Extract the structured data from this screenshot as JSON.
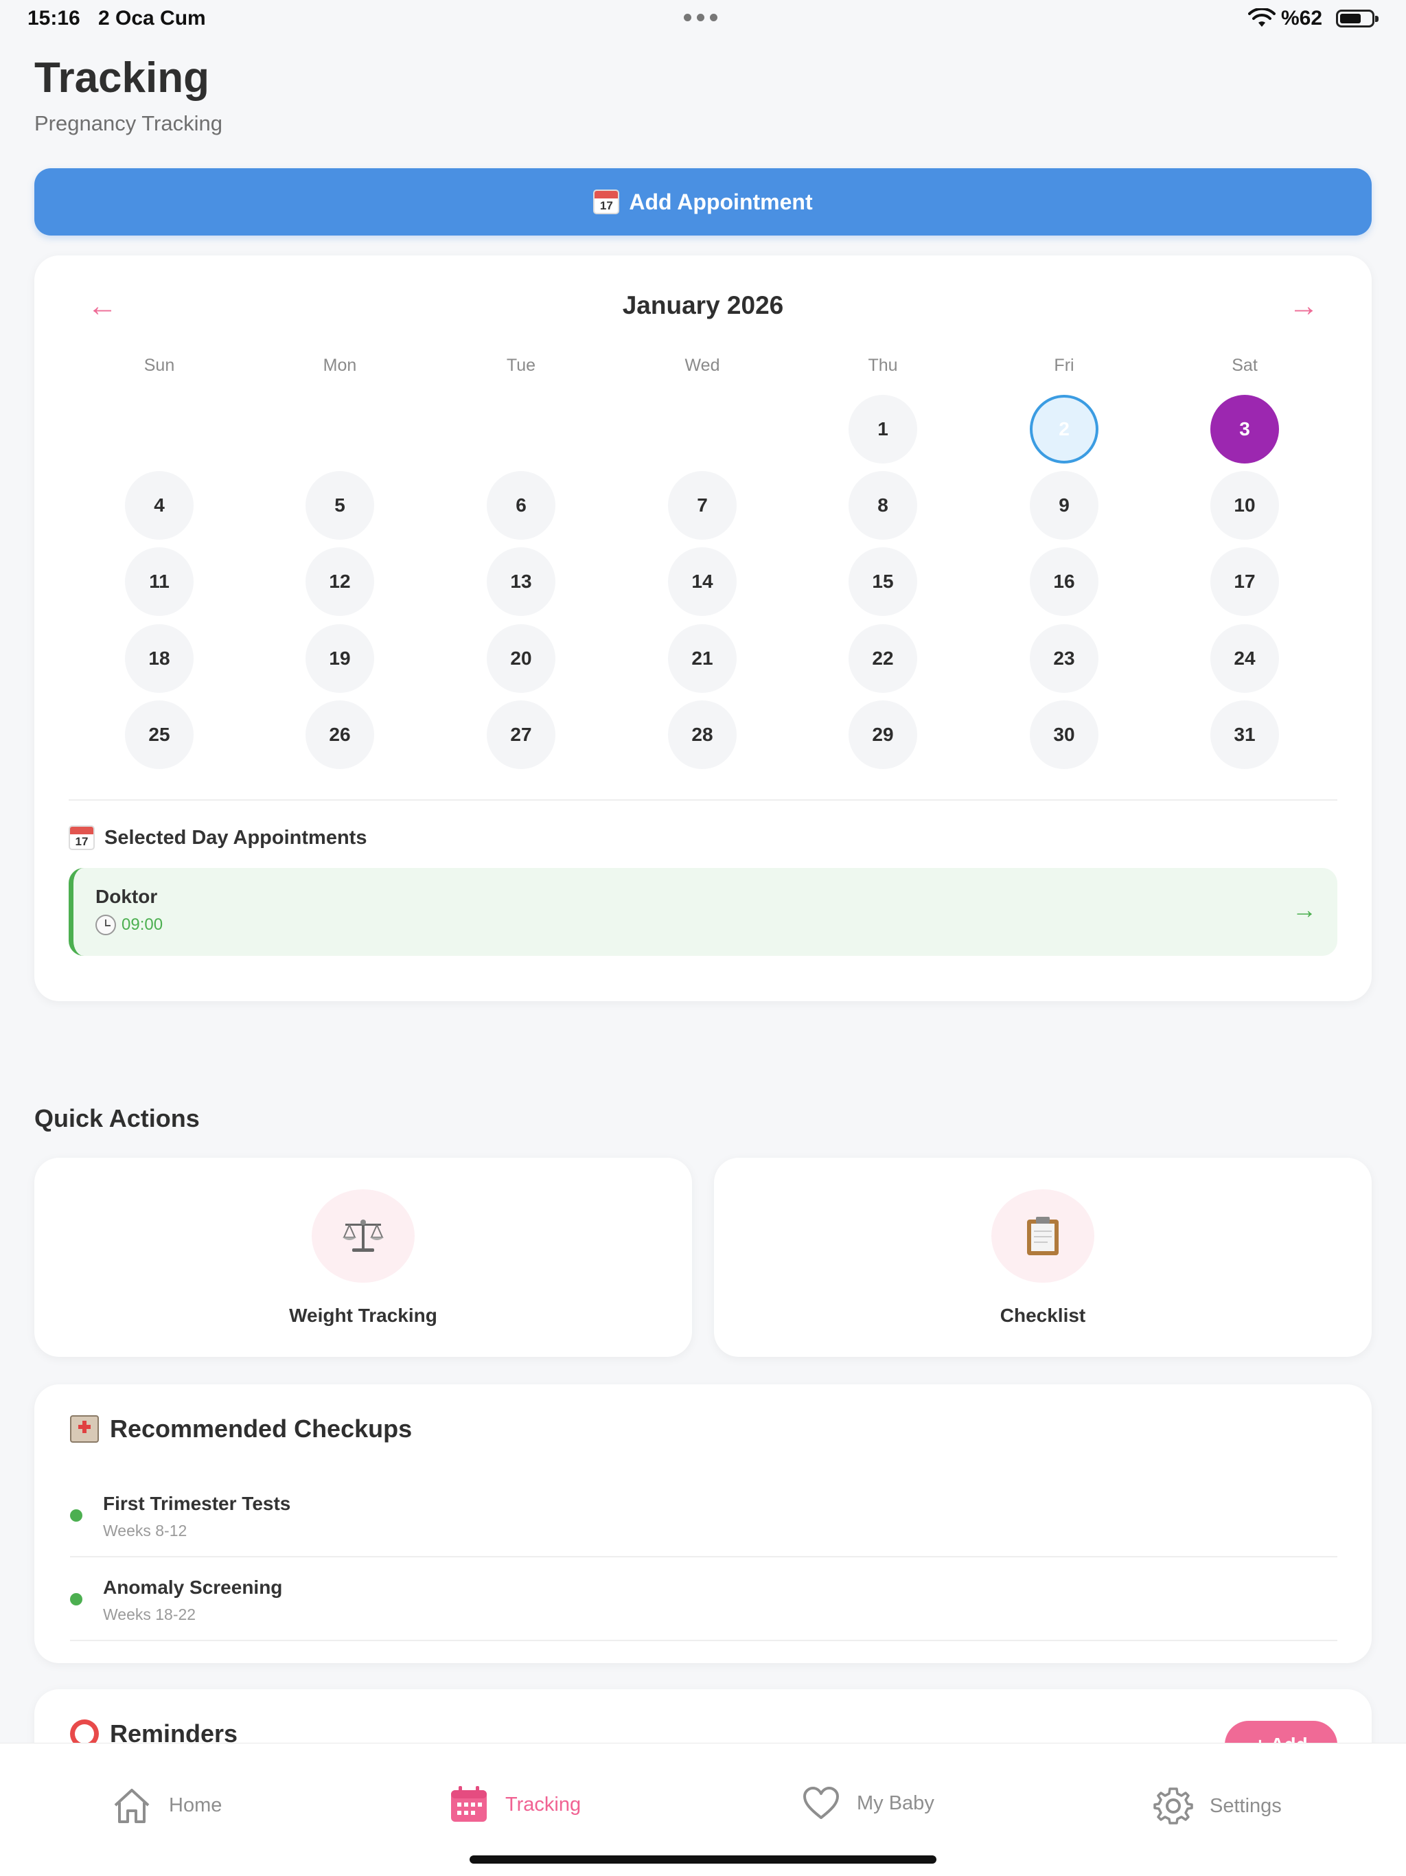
{
  "status_bar": {
    "time": "15:16",
    "date": "2 Oca Cum",
    "battery": "%62"
  },
  "header": {
    "title": "Tracking",
    "subtitle": "Pregnancy Tracking"
  },
  "add_button": {
    "icon": "calendar-icon",
    "calendar_day": "17",
    "label": "Add Appointment"
  },
  "calendar": {
    "prev_icon": "arrow-left-icon",
    "next_icon": "arrow-right-icon",
    "month_label": "January 2026",
    "weekdays": [
      "Sun",
      "Mon",
      "Tue",
      "Wed",
      "Thu",
      "Fri",
      "Sat"
    ],
    "first_weekday_index": 4,
    "days_in_month": 31,
    "today": 2,
    "selected": 3,
    "colors": {
      "today_border": "#3b9ce2",
      "selected_bg": "#9c27b0",
      "arrow": "#ee6b96"
    }
  },
  "selected_day": {
    "header_icon": "calendar-icon",
    "calendar_day": "17",
    "title": "Selected Day Appointments",
    "appointments": [
      {
        "name": "Doktor",
        "time": "09:00",
        "icon": "clock-icon"
      }
    ]
  },
  "quick_actions": {
    "title": "Quick Actions",
    "items": [
      {
        "label": "Weight Tracking",
        "icon": "scale-icon"
      },
      {
        "label": "Checklist",
        "icon": "clipboard-icon"
      }
    ]
  },
  "recommended": {
    "title": "Recommended Checkups",
    "icon": "hospital-icon",
    "items": [
      {
        "name": "First Trimester Tests",
        "weeks": "Weeks 8-12"
      },
      {
        "name": "Anomaly Screening",
        "weeks": "Weeks 18-22"
      }
    ]
  },
  "reminders": {
    "title": "Reminders",
    "icon": "alarm-clock-icon",
    "add_label": "+ Add"
  },
  "tabbar": {
    "active": "Tracking",
    "items": [
      {
        "label": "Home",
        "icon": "home-icon"
      },
      {
        "label": "Tracking",
        "icon": "calendar-icon"
      },
      {
        "label": "My Baby",
        "icon": "heart-icon"
      },
      {
        "label": "Settings",
        "icon": "gear-icon"
      }
    ]
  },
  "colors": {
    "primary": "#4a90e2",
    "accent_pink": "#f06292",
    "success": "#4caf50",
    "background": "#f6f7f9"
  }
}
